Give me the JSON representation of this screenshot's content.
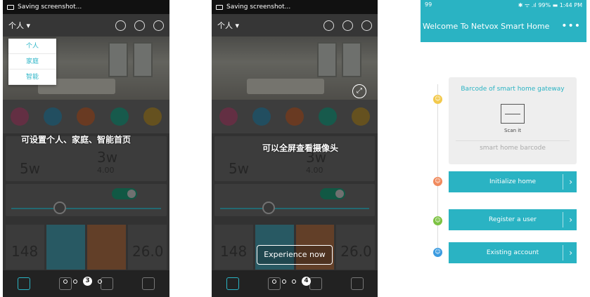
{
  "screen1": {
    "status_text": "Saving screenshot...",
    "selector": "个人 ▾",
    "menu": [
      "个人",
      "家庭",
      "智能"
    ],
    "power_values": [
      "5w",
      "3w",
      "4.00"
    ],
    "sensor_values": [
      "148",
      "26.0"
    ],
    "caption": "可设置个人、家庭、智能首页",
    "page_active": "3"
  },
  "screen2": {
    "status_text": "Saving screenshot...",
    "selector": "个人 ▾",
    "power_values": [
      "5w",
      "3w",
      "4.00"
    ],
    "sensor_values": [
      "148",
      "26.0"
    ],
    "caption": "可以全屏查看摄像头",
    "button": "Experience now",
    "page_active": "4"
  },
  "screen3": {
    "status_left": "99",
    "status_right": "✱ ᯤ .ıl 99% ▬ 1:44 PM",
    "title": "Welcome To Netvox Smart Home",
    "more": "•••",
    "gateway_title": "Barcode of smart home gateway",
    "scan_label": "Scan it",
    "barcode_placeholder": "smart home barcode",
    "buttons": [
      "Initialize home",
      "Register a user",
      "Existing account"
    ]
  },
  "colors": {
    "accent": "#2ab3c3",
    "step1": "#f2c94c",
    "step2": "#f08a5d",
    "step3": "#7cc242",
    "step4": "#3b9be0"
  }
}
